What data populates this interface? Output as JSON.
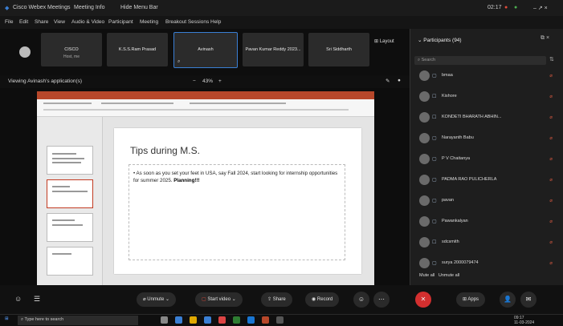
{
  "titlebar": {
    "app": "Cisco Webex Meetings",
    "meeting_info": "Meeting Info",
    "hide_menu": "Hide Menu Bar",
    "time": "02:17",
    "controls": "–  ↗  ×"
  },
  "menubar": [
    "File",
    "Edit",
    "Share",
    "View",
    "Audio & Video",
    "Participant",
    "Meeting",
    "Breakout Sessions",
    "Help"
  ],
  "tiles": [
    {
      "name": "CISCO",
      "sub": "Host, me"
    },
    {
      "name": "K.S.S.Ram Prasad",
      "sub": ""
    },
    {
      "name": "Avinash",
      "sub": ""
    },
    {
      "name": "Pavan Kumar Reddy 2023...",
      "sub": ""
    },
    {
      "name": "Sri Siddharth",
      "sub": ""
    }
  ],
  "layout_label": "Layout",
  "sharebar": {
    "viewing": "Viewing Avinash's application(s)",
    "zoom": "43%"
  },
  "slide": {
    "title": "Tips during M.S.",
    "bullet_main": "As soon as you set your feet in USA, say Fall 2024, start looking for internship opportunities for summer 2025.",
    "bullet_bold": "Planning!!!"
  },
  "participants": {
    "title": "Participants (94)",
    "search_placeholder": "Search",
    "list": [
      {
        "name": "bmaa",
        "icon": "video-icon"
      },
      {
        "name": "Kishore",
        "icon": "phone-icon"
      },
      {
        "name": "KONDETI BHARATH ABHIN...",
        "icon": "phone-icon"
      },
      {
        "name": "Narayanth Babu",
        "icon": "video-icon"
      },
      {
        "name": "P V Chaitanya",
        "icon": "video-icon"
      },
      {
        "name": "PADMA RAO PULICHERLA",
        "icon": "video-icon"
      },
      {
        "name": "pavan",
        "icon": "video-icon"
      },
      {
        "name": "Pawankalyan",
        "icon": "video-icon"
      },
      {
        "name": "sdcsmith",
        "icon": "phone-icon"
      },
      {
        "name": "surya 2000079474",
        "icon": "video-icon"
      }
    ],
    "mute_all": "Mute all",
    "unmute_all": "Unmute all"
  },
  "controls": {
    "unmute": "Unmute",
    "start_video": "Start video",
    "share": "Share",
    "record": "Record",
    "apps": "Apps"
  },
  "taskbar": {
    "search_placeholder": "Type here to search",
    "time": "09:17",
    "date": "11-03-2024"
  },
  "colors": {
    "accent": "#3a7fd4",
    "leave": "#d32f2f",
    "ppt": "#b7472a"
  }
}
